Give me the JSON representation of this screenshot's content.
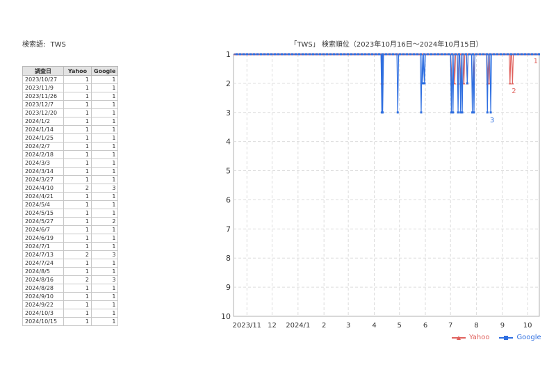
{
  "header": {
    "search_label": "検索語:",
    "search_term": "TWS"
  },
  "table": {
    "headers": [
      "調査日",
      "Yahoo",
      "Google"
    ],
    "rows": [
      [
        "2023/10/27",
        "1",
        "1"
      ],
      [
        "2023/11/9",
        "1",
        "1"
      ],
      [
        "2023/11/26",
        "1",
        "1"
      ],
      [
        "2023/12/7",
        "1",
        "1"
      ],
      [
        "2023/12/20",
        "1",
        "1"
      ],
      [
        "2024/1/2",
        "1",
        "1"
      ],
      [
        "2024/1/14",
        "1",
        "1"
      ],
      [
        "2024/1/25",
        "1",
        "1"
      ],
      [
        "2024/2/7",
        "1",
        "1"
      ],
      [
        "2024/2/18",
        "1",
        "1"
      ],
      [
        "2024/3/3",
        "1",
        "1"
      ],
      [
        "2024/3/14",
        "1",
        "1"
      ],
      [
        "2024/3/27",
        "1",
        "1"
      ],
      [
        "2024/4/10",
        "2",
        "3"
      ],
      [
        "2024/4/21",
        "1",
        "1"
      ],
      [
        "2024/5/4",
        "1",
        "1"
      ],
      [
        "2024/5/15",
        "1",
        "1"
      ],
      [
        "2024/5/27",
        "1",
        "2"
      ],
      [
        "2024/6/7",
        "1",
        "1"
      ],
      [
        "2024/6/19",
        "1",
        "1"
      ],
      [
        "2024/7/1",
        "1",
        "1"
      ],
      [
        "2024/7/13",
        "2",
        "3"
      ],
      [
        "2024/7/24",
        "1",
        "1"
      ],
      [
        "2024/8/5",
        "1",
        "1"
      ],
      [
        "2024/8/16",
        "2",
        "3"
      ],
      [
        "2024/8/28",
        "1",
        "1"
      ],
      [
        "2024/9/10",
        "1",
        "1"
      ],
      [
        "2024/9/22",
        "1",
        "1"
      ],
      [
        "2024/10/3",
        "1",
        "1"
      ],
      [
        "2024/10/15",
        "1",
        "1"
      ]
    ]
  },
  "chart_data": {
    "type": "line",
    "title": "「TWS」 検索順位（2023年10月16日～2024年10月15日）",
    "xlabel": "",
    "ylabel": "",
    "y_inverted": true,
    "ylim": [
      1,
      10
    ],
    "yticks": [
      "1",
      "2",
      "3",
      "4",
      "5",
      "6",
      "7",
      "8",
      "9",
      "10"
    ],
    "x_range": [
      "2023-10-16",
      "2024-10-15"
    ],
    "xticks": [
      {
        "date": "2023-11-01",
        "label": "2023/11"
      },
      {
        "date": "2023-12-01",
        "label": "12"
      },
      {
        "date": "2024-01-01",
        "label": "2024/1"
      },
      {
        "date": "2024-02-01",
        "label": "2"
      },
      {
        "date": "2024-03-01",
        "label": "3"
      },
      {
        "date": "2024-04-01",
        "label": "4"
      },
      {
        "date": "2024-05-01",
        "label": "5"
      },
      {
        "date": "2024-06-01",
        "label": "6"
      },
      {
        "date": "2024-07-01",
        "label": "7"
      },
      {
        "date": "2024-08-01",
        "label": "8"
      },
      {
        "date": "2024-09-01",
        "label": "9"
      },
      {
        "date": "2024-10-01",
        "label": "10"
      }
    ],
    "grid": true,
    "legend_position": "bottom-right",
    "series": [
      {
        "name": "Yahoo",
        "color": "#e0625e",
        "marker": "triangle",
        "end_label": "1",
        "dips": [
          {
            "date": "2024-04-10",
            "value": 2
          },
          {
            "date": "2024-04-11",
            "value": 2
          },
          {
            "date": "2024-07-02",
            "value": 2
          },
          {
            "date": "2024-07-06",
            "value": 2
          },
          {
            "date": "2024-07-10",
            "value": 2
          },
          {
            "date": "2024-07-13",
            "value": 2
          },
          {
            "date": "2024-07-17",
            "value": 2
          },
          {
            "date": "2024-07-21",
            "value": 2
          },
          {
            "date": "2024-07-29",
            "value": 2
          },
          {
            "date": "2024-08-14",
            "value": 2
          },
          {
            "date": "2024-08-16",
            "value": 2
          },
          {
            "date": "2024-09-10",
            "value": 2
          },
          {
            "date": "2024-09-13",
            "value": 2
          }
        ],
        "peak_label": {
          "date": "2024-09-13",
          "value": 2,
          "text": "2"
        }
      },
      {
        "name": "Google",
        "color": "#2f6fe0",
        "marker": "square",
        "dips": [
          {
            "date": "2024-04-10",
            "value": 3
          },
          {
            "date": "2024-04-11",
            "value": 3
          },
          {
            "date": "2024-04-29",
            "value": 3
          },
          {
            "date": "2024-05-27",
            "value": 3
          },
          {
            "date": "2024-05-29",
            "value": 2
          },
          {
            "date": "2024-05-31",
            "value": 2
          },
          {
            "date": "2024-07-02",
            "value": 3
          },
          {
            "date": "2024-07-04",
            "value": 3
          },
          {
            "date": "2024-07-10",
            "value": 3
          },
          {
            "date": "2024-07-13",
            "value": 3
          },
          {
            "date": "2024-07-15",
            "value": 3
          },
          {
            "date": "2024-07-21",
            "value": 2
          },
          {
            "date": "2024-07-27",
            "value": 3
          },
          {
            "date": "2024-07-29",
            "value": 3
          },
          {
            "date": "2024-08-14",
            "value": 3
          },
          {
            "date": "2024-08-18",
            "value": 3
          }
        ],
        "peak_label": {
          "date": "2024-08-18",
          "value": 3,
          "text": "3"
        }
      }
    ]
  }
}
